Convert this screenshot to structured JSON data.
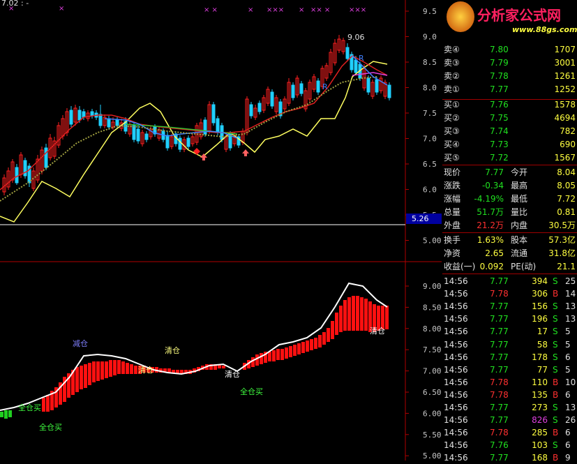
{
  "top": {
    "code_text": "7.02 : -"
  },
  "watermark": {
    "title": "分析家公式网",
    "url": "www.88gs.com"
  },
  "main_chart": {
    "y_ticks": [
      "9.5",
      "9.0",
      "8.5",
      "8.0",
      "7.5",
      "7.0",
      "6.5",
      "6.0",
      "5.5",
      "5.00"
    ],
    "peak_label": "9.06",
    "price_marker": "5.26",
    "r_label": "R"
  },
  "sub_chart": {
    "y_ticks": [
      "9.00",
      "8.50",
      "8.00",
      "7.50",
      "7.00",
      "6.50",
      "6.00",
      "5.50",
      "5.00"
    ],
    "labels": {
      "jian_cang": "减仓",
      "qing_cang_1": "清仓",
      "qing_cang_2": "清仓",
      "qing_cang_3": "清仓",
      "qing_cang_4": "清仓",
      "quan_cang_1": "全仓买",
      "quan_cang_2": "全仓买",
      "quan_cang_3": "全仓买"
    }
  },
  "order_book": {
    "asks": [
      {
        "label": "卖④",
        "price": "7.80",
        "vol": "1707"
      },
      {
        "label": "卖③",
        "price": "7.79",
        "vol": "3001"
      },
      {
        "label": "卖②",
        "price": "7.78",
        "vol": "1261"
      },
      {
        "label": "卖①",
        "price": "7.77",
        "vol": "1252"
      }
    ],
    "bids": [
      {
        "label": "买①",
        "price": "7.76",
        "vol": "1578"
      },
      {
        "label": "买②",
        "price": "7.75",
        "vol": "4694"
      },
      {
        "label": "买③",
        "price": "7.74",
        "vol": "782"
      },
      {
        "label": "买④",
        "price": "7.73",
        "vol": "690"
      },
      {
        "label": "买⑤",
        "price": "7.72",
        "vol": "1567"
      }
    ]
  },
  "quote": {
    "rows": [
      {
        "l1": "现价",
        "v1": "7.77",
        "l2": "今开",
        "v2": "8.04"
      },
      {
        "l1": "涨跌",
        "v1": "-0.34",
        "l2": "最高",
        "v2": "8.05"
      },
      {
        "l1": "涨幅",
        "v1": "-4.19%",
        "l2": "最低",
        "v2": "7.72"
      },
      {
        "l1": "总量",
        "v1": "51.7万",
        "l2": "量比",
        "v2": "0.81"
      },
      {
        "l1": "外盘",
        "v1": "21.2万",
        "l2": "内盘",
        "v2": "30.5万"
      }
    ],
    "rows2": [
      {
        "l1": "换手",
        "v1": "1.63%",
        "l2": "股本",
        "v2": "57.3亿"
      },
      {
        "l1": "净资",
        "v1": "2.65",
        "l2": "流通",
        "v2": "31.8亿"
      },
      {
        "l1": "收益(一)",
        "v1": "0.092",
        "l2": "PE(动)",
        "v2": "21.1"
      }
    ]
  },
  "ticks": [
    {
      "time": "14:56",
      "price": "7.77",
      "vol": "394",
      "side": "S",
      "n": "25"
    },
    {
      "time": "14:56",
      "price": "7.78",
      "vol": "306",
      "side": "B",
      "n": "14"
    },
    {
      "time": "14:56",
      "price": "7.77",
      "vol": "156",
      "side": "S",
      "n": "13"
    },
    {
      "time": "14:56",
      "price": "7.77",
      "vol": "196",
      "side": "S",
      "n": "13"
    },
    {
      "time": "14:56",
      "price": "7.77",
      "vol": "17",
      "side": "S",
      "n": "5"
    },
    {
      "time": "14:56",
      "price": "7.77",
      "vol": "58",
      "side": "S",
      "n": "5"
    },
    {
      "time": "14:56",
      "price": "7.77",
      "vol": "178",
      "side": "S",
      "n": "6"
    },
    {
      "time": "14:56",
      "price": "7.77",
      "vol": "77",
      "side": "S",
      "n": "5"
    },
    {
      "time": "14:56",
      "price": "7.78",
      "vol": "110",
      "side": "B",
      "n": "10"
    },
    {
      "time": "14:56",
      "price": "7.78",
      "vol": "135",
      "side": "B",
      "n": "6"
    },
    {
      "time": "14:56",
      "price": "7.77",
      "vol": "273",
      "side": "S",
      "n": "13"
    },
    {
      "time": "14:56",
      "price": "7.77",
      "vol": "826",
      "side": "S",
      "n": "26"
    },
    {
      "time": "14:56",
      "price": "7.78",
      "vol": "285",
      "side": "B",
      "n": "6"
    },
    {
      "time": "14:56",
      "price": "7.76",
      "vol": "103",
      "side": "S",
      "n": "6"
    },
    {
      "time": "14:56",
      "price": "7.77",
      "vol": "168",
      "side": "B",
      "n": "9"
    }
  ],
  "colors": {
    "up": "#ff2020",
    "down": "#20e0ff",
    "grid": "#b00000",
    "ma_yellow": "#ffff60"
  }
}
